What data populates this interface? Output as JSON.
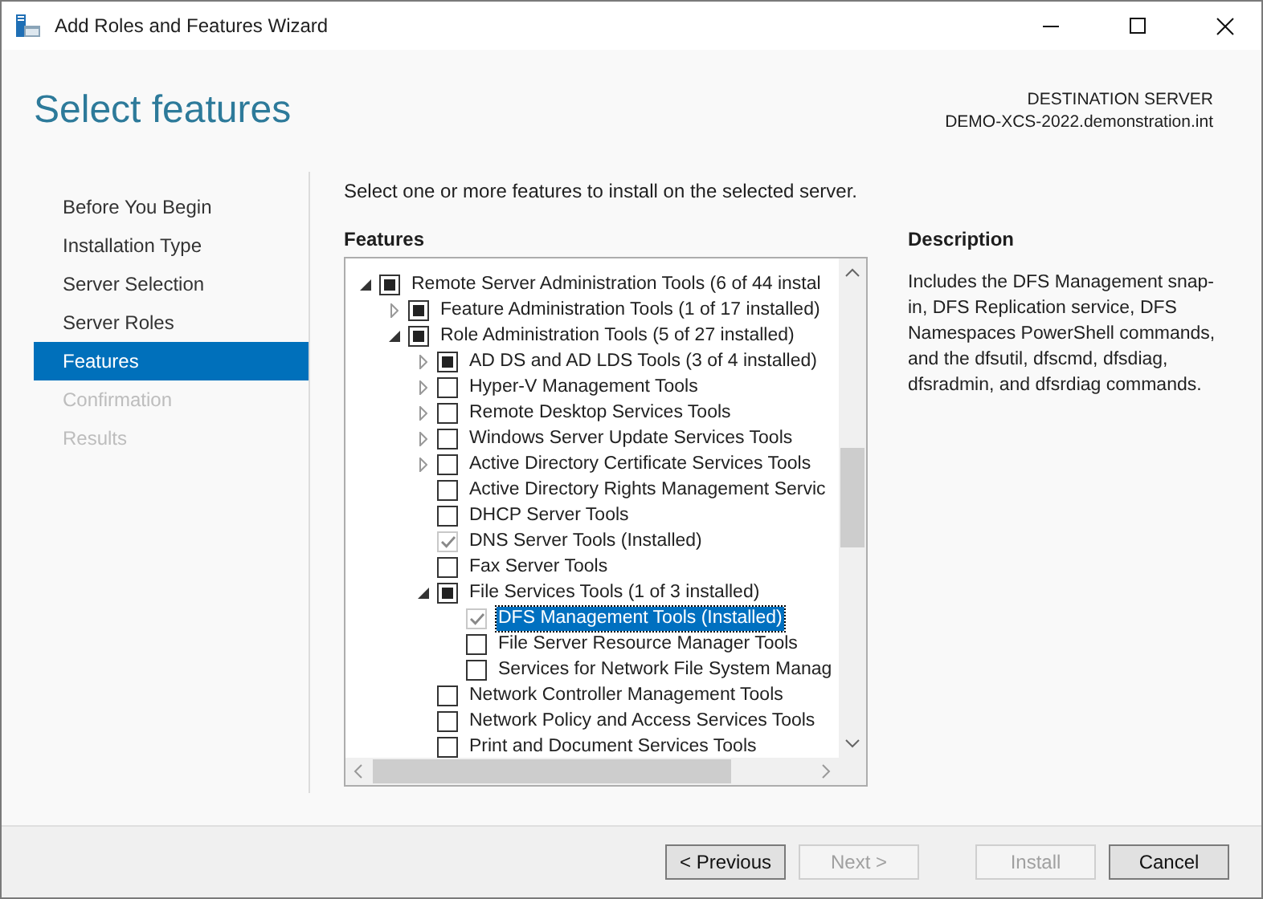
{
  "window": {
    "title": "Add Roles and Features Wizard"
  },
  "header": {
    "title": "Select features",
    "server_label": "DESTINATION SERVER",
    "server_name": "DEMO-XCS-2022.demonstration.int"
  },
  "steps": [
    {
      "label": "Before You Begin",
      "selected": false,
      "disabled": false
    },
    {
      "label": "Installation Type",
      "selected": false,
      "disabled": false
    },
    {
      "label": "Server Selection",
      "selected": false,
      "disabled": false
    },
    {
      "label": "Server Roles",
      "selected": false,
      "disabled": false
    },
    {
      "label": "Features",
      "selected": true,
      "disabled": false
    },
    {
      "label": "Confirmation",
      "selected": false,
      "disabled": true
    },
    {
      "label": "Results",
      "selected": false,
      "disabled": true
    }
  ],
  "instruction": "Select one or more features to install on the selected server.",
  "features_heading": "Features",
  "features": [
    {
      "label": "Remote Server Administration Tools (6 of 44 instal",
      "checked": false,
      "partial": true,
      "disabled": false,
      "expanded": true,
      "selected": false,
      "children": [
        {
          "label": "Feature Administration Tools (1 of 17 installed)",
          "checked": false,
          "partial": true,
          "disabled": false,
          "expanded": false,
          "selected": false
        },
        {
          "label": "Role Administration Tools (5 of 27 installed)",
          "checked": false,
          "partial": true,
          "disabled": false,
          "expanded": true,
          "selected": false,
          "children": [
            {
              "label": "AD DS and AD LDS Tools (3 of 4 installed)",
              "checked": false,
              "partial": true,
              "disabled": false,
              "expanded": false,
              "selected": false
            },
            {
              "label": "Hyper-V Management Tools",
              "checked": false,
              "partial": false,
              "disabled": false,
              "expanded": false,
              "selected": false
            },
            {
              "label": "Remote Desktop Services Tools",
              "checked": false,
              "partial": false,
              "disabled": false,
              "expanded": false,
              "selected": false
            },
            {
              "label": "Windows Server Update Services Tools",
              "checked": false,
              "partial": false,
              "disabled": false,
              "expanded": false,
              "selected": false
            },
            {
              "label": "Active Directory Certificate Services Tools",
              "checked": false,
              "partial": false,
              "disabled": false,
              "expanded": false,
              "selected": false
            },
            {
              "label": "Active Directory Rights Management Servic",
              "checked": false,
              "partial": false,
              "disabled": false,
              "selected": false
            },
            {
              "label": "DHCP Server Tools",
              "checked": false,
              "partial": false,
              "disabled": false,
              "selected": false
            },
            {
              "label": "DNS Server Tools (Installed)",
              "checked": true,
              "disabled": true,
              "selected": false
            },
            {
              "label": "Fax Server Tools",
              "checked": false,
              "partial": false,
              "disabled": false,
              "selected": false
            },
            {
              "label": "File Services Tools (1 of 3 installed)",
              "checked": false,
              "partial": true,
              "disabled": false,
              "expanded": true,
              "selected": false,
              "children": [
                {
                  "label": "DFS Management Tools (Installed)",
                  "checked": true,
                  "disabled": true,
                  "selected": true
                },
                {
                  "label": "File Server Resource Manager Tools",
                  "checked": false,
                  "partial": false,
                  "disabled": false,
                  "selected": false
                },
                {
                  "label": "Services for Network File System Manag",
                  "checked": false,
                  "partial": false,
                  "disabled": false,
                  "selected": false
                }
              ]
            },
            {
              "label": "Network Controller Management Tools",
              "checked": false,
              "partial": false,
              "disabled": false,
              "selected": false
            },
            {
              "label": "Network Policy and Access Services Tools",
              "checked": false,
              "partial": false,
              "disabled": false,
              "selected": false
            },
            {
              "label": "Print and Document Services Tools",
              "checked": false,
              "partial": false,
              "disabled": false,
              "selected": false
            }
          ]
        }
      ]
    }
  ],
  "description_heading": "Description",
  "description": "Includes the DFS Management snap-in, DFS Replication service, DFS Namespaces PowerShell commands, and the dfsutil, dfscmd, dfsdiag, dfsradmin, and dfsrdiag commands.",
  "buttons": [
    {
      "label": "< Previous",
      "disabled": false
    },
    {
      "label": "Next >",
      "disabled": true
    },
    {
      "label": "Install",
      "disabled": true
    },
    {
      "label": "Cancel",
      "disabled": false
    }
  ]
}
